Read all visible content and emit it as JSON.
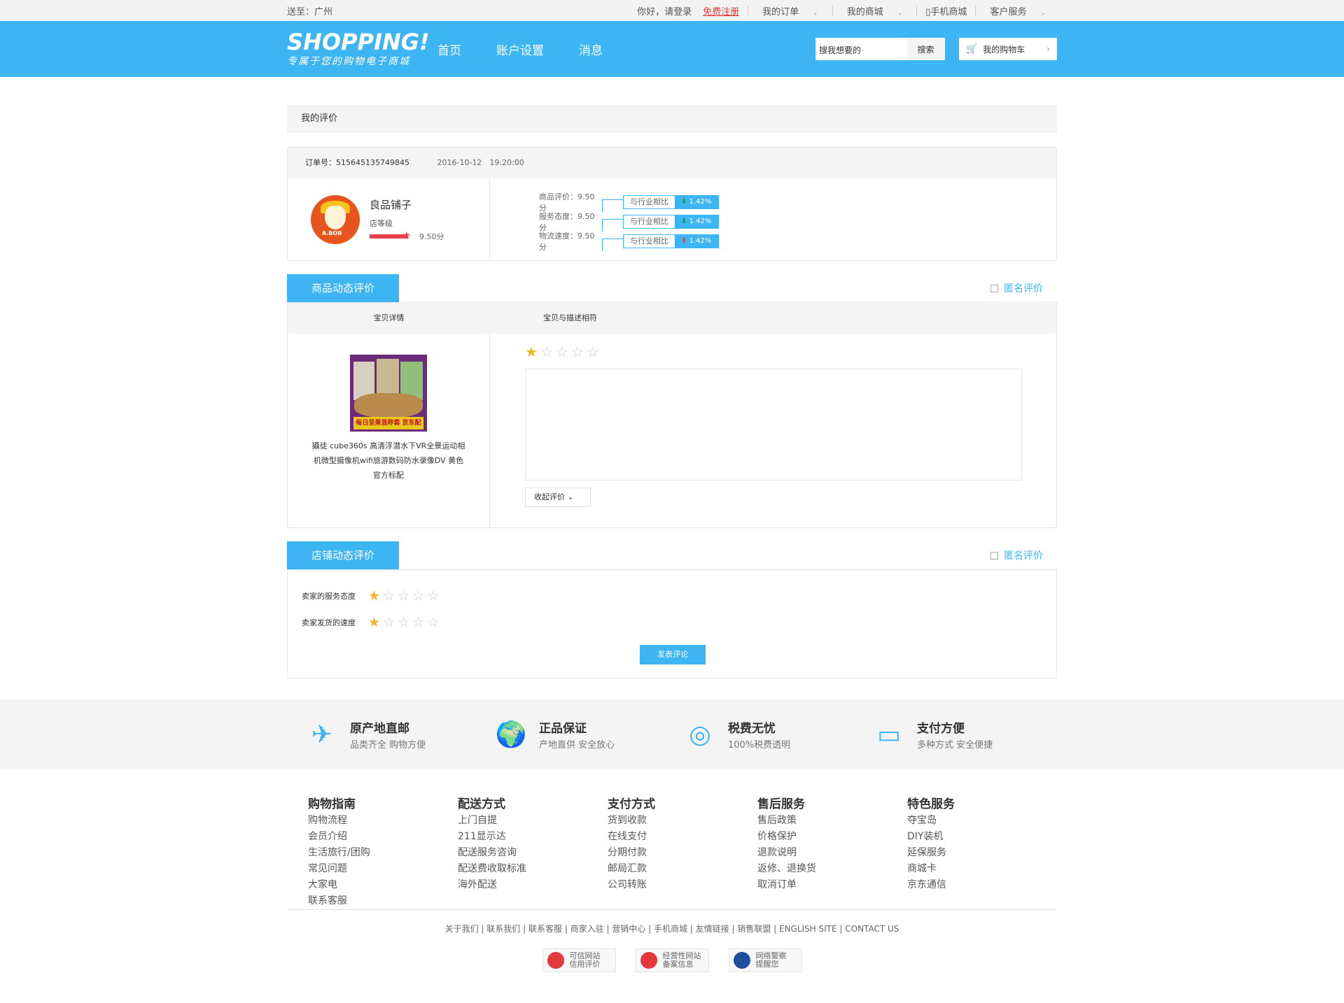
{
  "topbar": {
    "location": "送至：广州",
    "greeting": "你好，请登录",
    "register": "免费注册",
    "my_orders": "我的订单",
    "my_mall": "我的商城",
    "mobile": "▯手机商城",
    "service": "客户服务"
  },
  "header": {
    "logo_text": "SHOPPING!",
    "logo_slogan": "专属于您的购物电子商城",
    "nav": [
      "首页",
      "账户设置",
      "消息"
    ],
    "search_placeholder": "搜我想要的",
    "search_button": "搜索",
    "cart": "我的购物车"
  },
  "page_title": "我的评价",
  "order": {
    "number": "订单号：515645135749845",
    "date": "2016-10-12　19:20:00",
    "shop_name": "良品铺子",
    "shop_level_label": "店等级",
    "shop_score": "9.50分",
    "shop_logo_text": "A.BOB",
    "ratings": [
      {
        "label": "商品评价：9.50分",
        "compare": "与行业相比",
        "value": "1.42%",
        "trend": "down",
        "arrow": "⬇"
      },
      {
        "label": "服务态度：9.50分",
        "compare": "与行业相比",
        "value": "1.42%",
        "trend": "down",
        "arrow": "⬇"
      },
      {
        "label": "物流速度：9.50分",
        "compare": "与行业相比",
        "value": "1.42%",
        "trend": "up",
        "arrow": "⬆"
      }
    ]
  },
  "goods_section": {
    "tab": "商品动态评价",
    "anonymous": "匿名评价",
    "col1": "宝贝详情",
    "col2": "宝贝与描述相符",
    "product_banner": "每日坚果混称套 京东配送 货到付款",
    "product_name": "攝徒 cube360s 高清浮潜水下VR全景运动相机微型摄像机wifi旅游数码防水录像DV 黄色 官方标配",
    "rating": 1,
    "collapse": "收起评价 ⌄"
  },
  "store_section": {
    "tab": "店铺动态评价",
    "anonymous": "匿名评价",
    "row1": "卖家的服务态度",
    "row2": "卖家发货的速度",
    "rating1": 1,
    "rating2": 1,
    "submit": "发表评论"
  },
  "features": [
    {
      "icon": "airplane-icon",
      "title": "原产地直邮",
      "sub": "品类齐全 购物方便"
    },
    {
      "icon": "globe-icon",
      "title": "正品保证",
      "sub": "产地直供 安全放心"
    },
    {
      "icon": "tax-icon",
      "title": "税费无忧",
      "sub": "100%税费透明"
    },
    {
      "icon": "card-icon",
      "title": "支付方便",
      "sub": "多种方式 安全便捷"
    }
  ],
  "footer_columns": [
    {
      "title": "购物指南",
      "items": [
        "购物流程",
        "会员介绍",
        "生活旅行/团购",
        "常见问题",
        "大家电",
        "联系客服"
      ]
    },
    {
      "title": "配送方式",
      "items": [
        "上门自提",
        "211显示达",
        "配送服务咨询",
        "配送费收取标准",
        "海外配送"
      ]
    },
    {
      "title": "支付方式",
      "items": [
        "货到收款",
        "在线支付",
        "分期付款",
        "邮局汇款",
        "公司转账"
      ]
    },
    {
      "title": "售后服务",
      "items": [
        "售后政策",
        "价格保护",
        "退款说明",
        "返修、退换货",
        "取消订单"
      ]
    },
    {
      "title": "特色服务",
      "items": [
        "夺宝岛",
        "DIY装机",
        "延保服务",
        "商城卡",
        "京东通信"
      ]
    }
  ],
  "footer_links": "关于我们 | 联系我们 | 联系客服 | 商家入驻 | 营销中心 | 手机商城 | 友情链接 | 销售联盟 | ENGLISH SITE | CONTACT US",
  "badges": [
    {
      "l1": "可信网站",
      "l2": "信用评价"
    },
    {
      "l1": "经营性网站",
      "l2": "备案信息"
    },
    {
      "l1": "网络警察",
      "l2": "提醒您"
    }
  ]
}
